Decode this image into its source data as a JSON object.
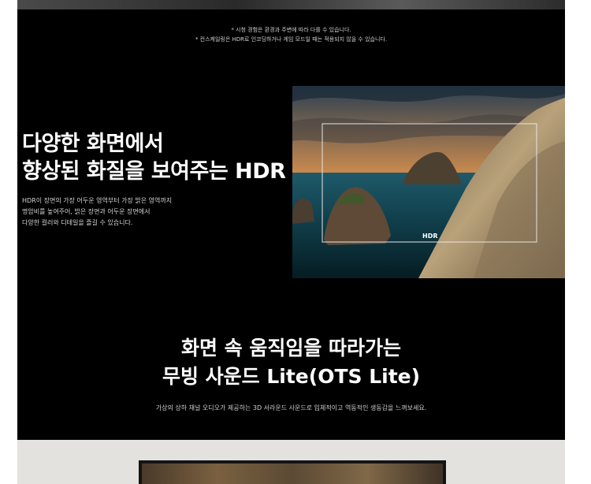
{
  "notes": {
    "line1": "* 시청 경험은 환경과 주변에 따라 다를 수 있습니다.",
    "line2": "* 컨스케일링은 HDR로 인코딩하거나 게임 모드일 때는 적용되지 않을 수 있습니다."
  },
  "hdr_section": {
    "title_line1": "다양한 화면에서",
    "title_line2": "향상된 화질을 보여주는 HDR",
    "desc_line1": "HDR이 장면의 가장 어두운 영역부터 가장 밝은 영역까지",
    "desc_line2": "명암비를 높여주어, 밝은 장면과 어두운 장면에서",
    "desc_line3": "다양한 컬러와 디테일을 즐길 수 있습니다.",
    "image_label": "HDR"
  },
  "ots_section": {
    "title_line1": "화면 속 움직임을 따라가는",
    "title_line2": "무빙 사운드 Lite(OTS Lite)",
    "desc": "가상의 상하 채널 오디오가 제공하는 3D 서라운드 사운드로 입체적이고 역동적인 생동감을 느껴보세요."
  }
}
